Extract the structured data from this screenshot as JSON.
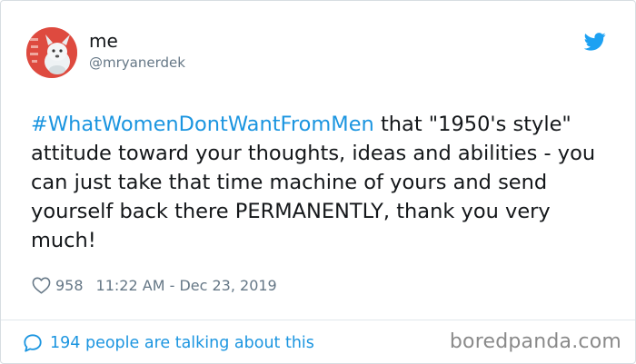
{
  "author": {
    "display_name": "me",
    "handle": "@mryanerdek"
  },
  "tweet": {
    "hashtag": "#WhatWomenDontWantFromMen",
    "body": " that \"1950's style\" attitude toward your thoughts, ideas and abilities - you can just take that time machine of yours and send yourself back there PERMANENTLY, thank you very much!"
  },
  "meta": {
    "like_count": "958",
    "timestamp": "11:22 AM - Dec 23, 2019"
  },
  "conversation": {
    "label": "194 people are talking about this"
  },
  "watermark": "boredpanda.com",
  "icons": {
    "brand": "twitter-bird-icon",
    "like": "heart-icon",
    "reply": "speech-bubble-icon"
  },
  "colors": {
    "link": "#1b95e0",
    "secondary_text": "#657786",
    "primary_text": "#14171a",
    "avatar_background": "#d93a32"
  }
}
